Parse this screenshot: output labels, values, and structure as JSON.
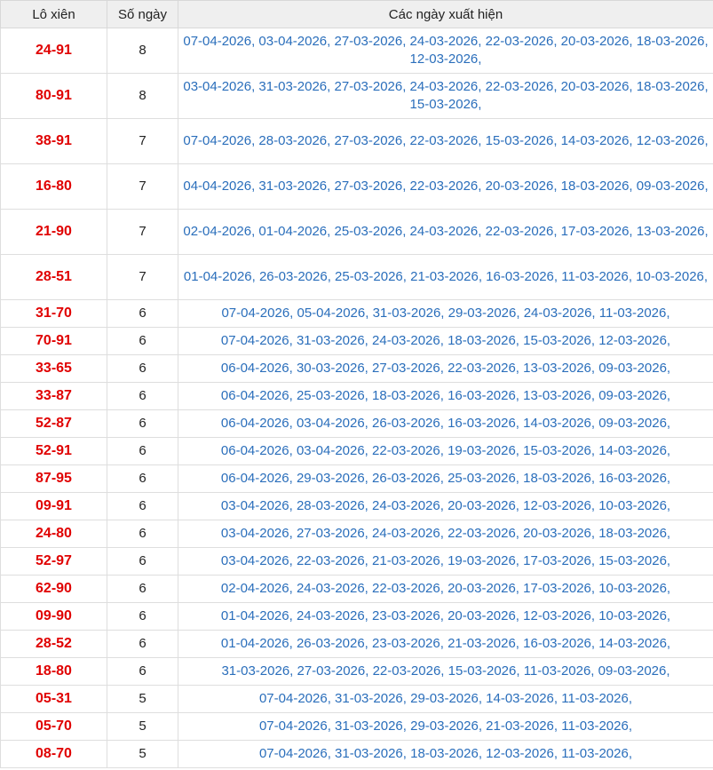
{
  "headers": {
    "pair": "Lô xiên",
    "count": "Số ngày",
    "dates": "Các ngày xuất hiện"
  },
  "rows": [
    {
      "pair": "24-91",
      "count": "8",
      "dates": "07-04-2026, 03-04-2026, 27-03-2026, 24-03-2026, 22-03-2026, 20-03-2026, 18-03-2026, 12-03-2026,"
    },
    {
      "pair": "80-91",
      "count": "8",
      "dates": "03-04-2026, 31-03-2026, 27-03-2026, 24-03-2026, 22-03-2026, 20-03-2026, 18-03-2026, 15-03-2026,"
    },
    {
      "pair": "38-91",
      "count": "7",
      "dates": "07-04-2026, 28-03-2026, 27-03-2026, 22-03-2026, 15-03-2026, 14-03-2026, 12-03-2026,"
    },
    {
      "pair": "16-80",
      "count": "7",
      "dates": "04-04-2026, 31-03-2026, 27-03-2026, 22-03-2026, 20-03-2026, 18-03-2026, 09-03-2026,"
    },
    {
      "pair": "21-90",
      "count": "7",
      "dates": "02-04-2026, 01-04-2026, 25-03-2026, 24-03-2026, 22-03-2026, 17-03-2026, 13-03-2026,"
    },
    {
      "pair": "28-51",
      "count": "7",
      "dates": "01-04-2026, 26-03-2026, 25-03-2026, 21-03-2026, 16-03-2026, 11-03-2026, 10-03-2026,"
    },
    {
      "pair": "31-70",
      "count": "6",
      "dates": "07-04-2026, 05-04-2026, 31-03-2026, 29-03-2026, 24-03-2026, 11-03-2026,"
    },
    {
      "pair": "70-91",
      "count": "6",
      "dates": "07-04-2026, 31-03-2026, 24-03-2026, 18-03-2026, 15-03-2026, 12-03-2026,"
    },
    {
      "pair": "33-65",
      "count": "6",
      "dates": "06-04-2026, 30-03-2026, 27-03-2026, 22-03-2026, 13-03-2026, 09-03-2026,"
    },
    {
      "pair": "33-87",
      "count": "6",
      "dates": "06-04-2026, 25-03-2026, 18-03-2026, 16-03-2026, 13-03-2026, 09-03-2026,"
    },
    {
      "pair": "52-87",
      "count": "6",
      "dates": "06-04-2026, 03-04-2026, 26-03-2026, 16-03-2026, 14-03-2026, 09-03-2026,"
    },
    {
      "pair": "52-91",
      "count": "6",
      "dates": "06-04-2026, 03-04-2026, 22-03-2026, 19-03-2026, 15-03-2026, 14-03-2026,"
    },
    {
      "pair": "87-95",
      "count": "6",
      "dates": "06-04-2026, 29-03-2026, 26-03-2026, 25-03-2026, 18-03-2026, 16-03-2026,"
    },
    {
      "pair": "09-91",
      "count": "6",
      "dates": "03-04-2026, 28-03-2026, 24-03-2026, 20-03-2026, 12-03-2026, 10-03-2026,"
    },
    {
      "pair": "24-80",
      "count": "6",
      "dates": "03-04-2026, 27-03-2026, 24-03-2026, 22-03-2026, 20-03-2026, 18-03-2026,"
    },
    {
      "pair": "52-97",
      "count": "6",
      "dates": "03-04-2026, 22-03-2026, 21-03-2026, 19-03-2026, 17-03-2026, 15-03-2026,"
    },
    {
      "pair": "62-90",
      "count": "6",
      "dates": "02-04-2026, 24-03-2026, 22-03-2026, 20-03-2026, 17-03-2026, 10-03-2026,"
    },
    {
      "pair": "09-90",
      "count": "6",
      "dates": "01-04-2026, 24-03-2026, 23-03-2026, 20-03-2026, 12-03-2026, 10-03-2026,"
    },
    {
      "pair": "28-52",
      "count": "6",
      "dates": "01-04-2026, 26-03-2026, 23-03-2026, 21-03-2026, 16-03-2026, 14-03-2026,"
    },
    {
      "pair": "18-80",
      "count": "6",
      "dates": "31-03-2026, 27-03-2026, 22-03-2026, 15-03-2026, 11-03-2026, 09-03-2026,"
    },
    {
      "pair": "05-31",
      "count": "5",
      "dates": "07-04-2026, 31-03-2026, 29-03-2026, 14-03-2026, 11-03-2026,"
    },
    {
      "pair": "05-70",
      "count": "5",
      "dates": "07-04-2026, 31-03-2026, 29-03-2026, 21-03-2026, 11-03-2026,"
    },
    {
      "pair": "08-70",
      "count": "5",
      "dates": "07-04-2026, 31-03-2026, 18-03-2026, 12-03-2026, 11-03-2026,"
    }
  ]
}
